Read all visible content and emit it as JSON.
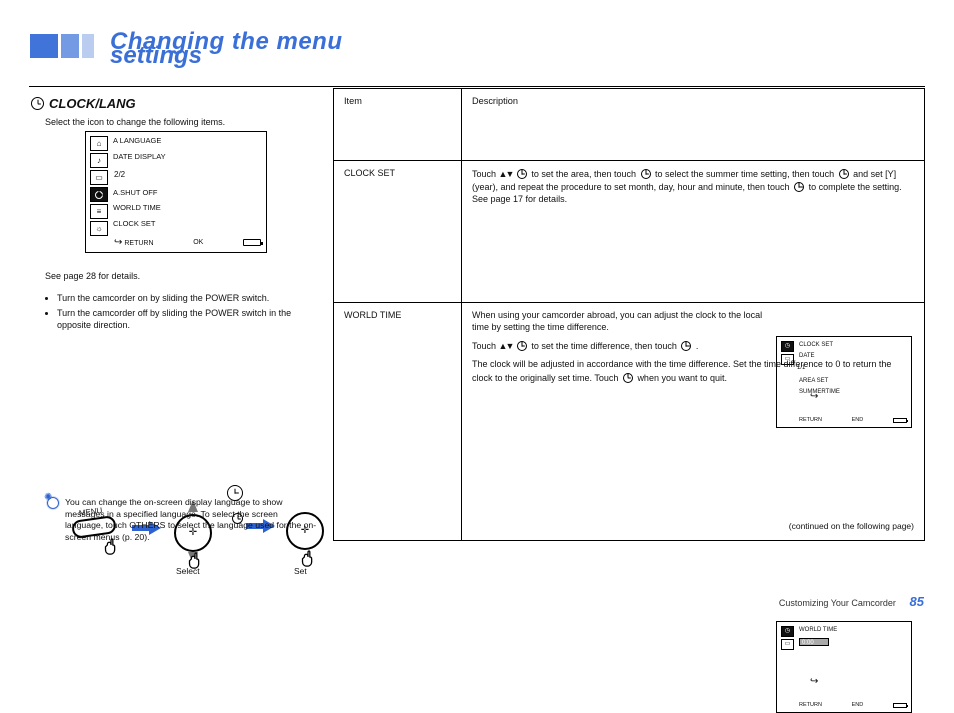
{
  "header": {
    "title_line1": "Changing the menu",
    "title_line2": "settings"
  },
  "left": {
    "heading": "CLOCK/LANG",
    "intro": "Select the icon to change the following items.",
    "lcd1": {
      "tab_lang": "A LANGUAGE",
      "tab_date": "DATE DISPLAY",
      "pageno": "2/2",
      "setup": "A.SHUT OFF",
      "world": "WORLD TIME",
      "usb": "CLOCK SET",
      "ret_glyph": "⤶",
      "bottom_return": "RETURN",
      "bottom_ok": "OK"
    },
    "paragraph": "See page 28 for details.",
    "bullet1": "Turn the camcorder on by sliding the POWER switch.",
    "bullet2": "Turn the camcorder off by sliding the POWER switch in the opposite direction.",
    "flow": {
      "menu_label": "MENU",
      "dial_cross": "✛",
      "select_label": "Select",
      "set_label": "Set"
    },
    "hint": "You can change the on-screen display language to show messages in a specified language. To select the screen language, touch OTHERS to select the language used for the on-screen menus (p. 20)."
  },
  "table": {
    "row1": {
      "item": "Item",
      "desc": "Description"
    },
    "row2": {
      "item": "CLOCK SET",
      "desc_pre": "Touch",
      "desc_mid": "to set the area, then touch",
      "desc_post": "to select the summer time setting, then touch",
      "desc_tail": "and set [Y] (year), and repeat the procedure to set month, day, hour and minute, then touch",
      "desc_end": "to complete the setting.",
      "see": "See page 17 for details.",
      "mlcd": {
        "row1": "CLOCK SET",
        "row2": "DATE",
        "pageno": "1/1",
        "row3": "AREA SET",
        "row4": "SUMMERTIME",
        "ret": "⤶",
        "btm_l": "RETURN",
        "btm_r": "END"
      }
    },
    "row3": {
      "item": "WORLD TIME",
      "desc_l1": "When using your camcorder abroad, you can adjust the clock to the local time by setting the time difference.",
      "desc_l2": "Touch",
      "desc_l2_mid": "to set the time difference, then touch",
      "desc_l2_end": ".",
      "desc_l3": "The clock will be adjusted in accordance with the time difference. Set the time difference to 0 to return the clock to the originally set time. Touch",
      "desc_l3_end": "when you want to quit.",
      "mlcd": {
        "row1": "WORLD TIME",
        "highlight": "0:00",
        "ret": "⤶",
        "btm_l": "RETURN",
        "btm_r": "END"
      },
      "continued": "(continued on the following page)"
    }
  },
  "footer": {
    "section": "Customizing Your Camcorder",
    "page": "85"
  },
  "misc": {
    "ud": "▲▼"
  }
}
